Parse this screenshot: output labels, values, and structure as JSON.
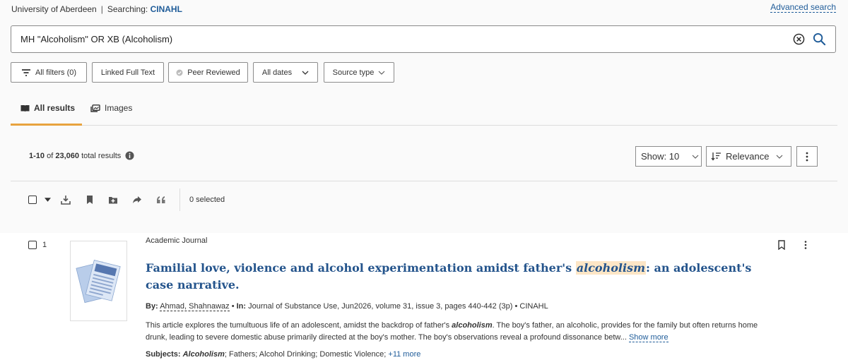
{
  "header": {
    "institution": "University of Aberdeen",
    "separator": "|",
    "searching_label": "Searching:",
    "database": "CINAHL",
    "advanced_search": "Advanced search"
  },
  "search": {
    "query": "MH \"Alcoholism\" OR XB (Alcoholism)"
  },
  "filters": {
    "all_filters": "All filters (0)",
    "linked_full_text": "Linked Full Text",
    "peer_reviewed": "Peer Reviewed",
    "all_dates": "All dates",
    "source_type": "Source type"
  },
  "tabs": {
    "all_results": "All results",
    "images": "Images"
  },
  "results_summary": {
    "range": "1-10",
    "of": "of",
    "total": "23,060",
    "suffix": "total results"
  },
  "controls": {
    "show": "Show: 10",
    "sort": "Relevance"
  },
  "toolbar": {
    "selected": "0 selected"
  },
  "results": [
    {
      "number": "1",
      "pub_type": "Academic Journal",
      "title_before": "Familial love, violence and alcohol experimentation amidst father's ",
      "title_highlight": "alcoholism",
      "title_after": ": an adolescent's case narrative.",
      "by_label": "By:",
      "author": "Ahmad, Shahnawaz",
      "bullet": "•",
      "in_label": "In:",
      "source": "Journal of Substance Use, Jun2026, volume 31, issue 3, pages 440-442 (3p)",
      "database": "CINAHL",
      "abstract_1": "This article explores the tumultuous life of an adolescent, amidst the backdrop of father's ",
      "abstract_hl": "alcoholism",
      "abstract_2": ". The boy's father, an alcoholic, provides for the family but often returns home drunk, leading to severe domestic abuse primarily directed at the boy's mother. The boy's observations reveal a profound dissonance betw...",
      "show_more": "Show more",
      "subjects_label": "Subjects:",
      "subject_hl": "Alcoholism",
      "subjects_rest": "; Fathers; Alcohol Drinking; Domestic Violence;",
      "subjects_more": "+11 more"
    }
  ],
  "colors": {
    "link": "#1f5c99",
    "title": "#24548c",
    "accent": "#e8a33e",
    "highlight": "#fde6c6"
  }
}
